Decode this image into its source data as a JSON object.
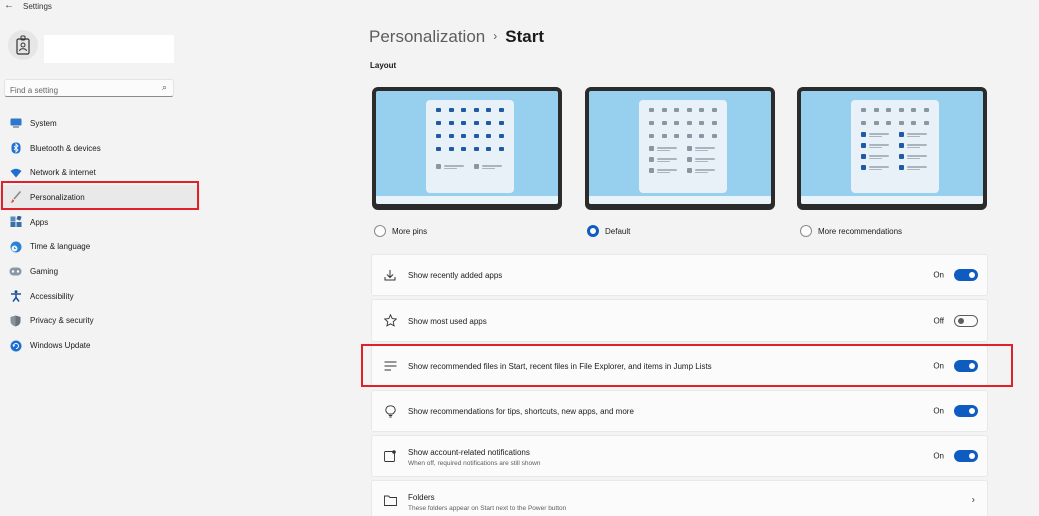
{
  "window": {
    "title": "Settings"
  },
  "search": {
    "placeholder": "Find a setting"
  },
  "sidebar": {
    "items": [
      {
        "label": "System",
        "icon": "system-icon"
      },
      {
        "label": "Bluetooth & devices",
        "icon": "bluetooth-icon"
      },
      {
        "label": "Network & internet",
        "icon": "network-icon"
      },
      {
        "label": "Personalization",
        "icon": "brush-icon",
        "active": true
      },
      {
        "label": "Apps",
        "icon": "apps-icon"
      },
      {
        "label": "Time & language",
        "icon": "globe-clock-icon"
      },
      {
        "label": "Gaming",
        "icon": "gamepad-icon"
      },
      {
        "label": "Accessibility",
        "icon": "accessibility-icon"
      },
      {
        "label": "Privacy & security",
        "icon": "shield-icon"
      },
      {
        "label": "Windows Update",
        "icon": "update-icon"
      }
    ]
  },
  "breadcrumb": {
    "parent": "Personalization",
    "separator": "›",
    "current": "Start"
  },
  "layout": {
    "title": "Layout",
    "options": [
      {
        "label": "More pins",
        "selected": false
      },
      {
        "label": "Default",
        "selected": true
      },
      {
        "label": "More recommendations",
        "selected": false
      }
    ]
  },
  "settings": [
    {
      "label": "Show recently added apps",
      "state": "On",
      "toggle": true,
      "icon": "download-icon"
    },
    {
      "label": "Show most used apps",
      "state": "Off",
      "toggle": false,
      "icon": "star-icon"
    },
    {
      "label": "Show recommended files in Start, recent files in File Explorer, and items in Jump Lists",
      "state": "On",
      "toggle": true,
      "icon": "list-icon"
    },
    {
      "label": "Show recommendations for tips, shortcuts, new apps, and more",
      "state": "On",
      "toggle": true,
      "icon": "lightbulb-icon"
    },
    {
      "label": "Show account-related notifications",
      "sub": "When off, required notifications are still shown",
      "state": "On",
      "toggle": true,
      "icon": "notification-icon"
    },
    {
      "label": "Folders",
      "sub": "These folders appear on Start next to the Power button",
      "icon": "folder-icon",
      "chevron": "›"
    }
  ],
  "colors": {
    "accent": "#0f5cc0",
    "highlight": "#e0202a",
    "background": "#f3f3f3"
  }
}
